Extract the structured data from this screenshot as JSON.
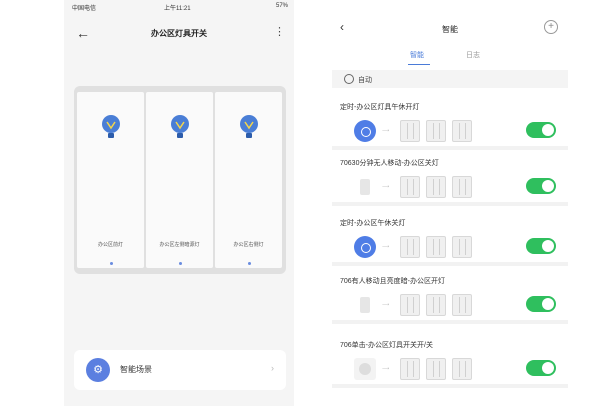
{
  "left_screen": {
    "status": {
      "carrier": "中国电信",
      "time": "上午11:21",
      "battery": "57%"
    },
    "title": "办公区灯具开关",
    "gangs": [
      {
        "label": "办公区前灯"
      },
      {
        "label": "办公区左侧暗源灯"
      },
      {
        "label": "办公区右侧灯"
      }
    ],
    "scene": {
      "label": "智能场景"
    }
  },
  "right_screen": {
    "title": "智能",
    "tabs": [
      {
        "label": "智能",
        "active": true
      },
      {
        "label": "日志",
        "active": false
      }
    ],
    "auto_label": "自动",
    "rules": [
      {
        "title": "定时-办公区灯具午休开灯",
        "trigger": "timer-circle",
        "enabled": true
      },
      {
        "title": "70630分钟无人移动-办公区关灯",
        "trigger": "sensor",
        "enabled": true
      },
      {
        "title": "定时-办公区午休关灯",
        "trigger": "timer-circle",
        "enabled": true
      },
      {
        "title": "706有人移动且亮度暗-办公区开灯",
        "trigger": "sensor",
        "enabled": true
      },
      {
        "title": "706单击-办公区灯具开关开/关",
        "trigger": "button",
        "enabled": true
      }
    ]
  },
  "icons": {
    "bulb": "bulb-icon",
    "scene": "scene-icon",
    "toggle_on_color": "#2fbf5e",
    "accent": "#4a7bd8"
  }
}
